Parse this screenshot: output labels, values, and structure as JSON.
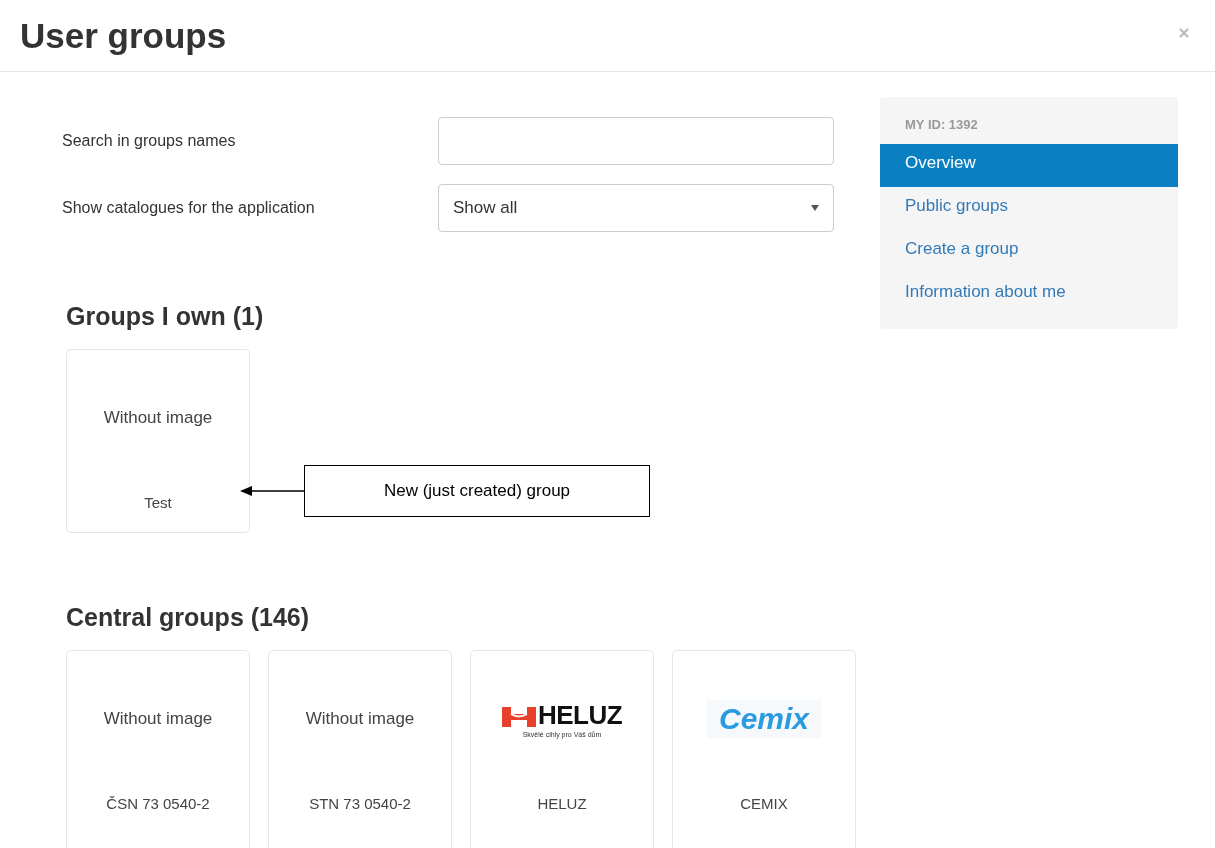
{
  "title": "User groups",
  "form": [
    {
      "kind": "text",
      "label": "Search in groups names"
    },
    {
      "kind": "select",
      "label": "Show catalogues for the application",
      "value": "Show all"
    }
  ],
  "sidebar": {
    "header": "MY ID: 1392",
    "items": [
      {
        "label": "Overview",
        "selected": true
      },
      {
        "label": "Public groups",
        "selected": false
      },
      {
        "label": "Create a group",
        "selected": false
      },
      {
        "label": "Information about me",
        "selected": false
      }
    ]
  },
  "sections": [
    {
      "heading": "Groups I own (1)",
      "groups": [
        {
          "image": {
            "kind": "none",
            "text": "Without image"
          },
          "name": "Test",
          "annotation": "New (just created) group"
        }
      ]
    },
    {
      "heading": "Central groups (146)",
      "groups": [
        {
          "image": {
            "kind": "none",
            "text": "Without image"
          },
          "name": "ČSN 73 0540-2"
        },
        {
          "image": {
            "kind": "none",
            "text": "Without image"
          },
          "name": "STN 73 0540-2"
        },
        {
          "image": {
            "kind": "heluz",
            "text": "HELUZ",
            "tagline": "Skvělé cihly pro Váš dům"
          },
          "name": "HELUZ"
        },
        {
          "image": {
            "kind": "cemix",
            "text": "Cemix"
          },
          "name": "CEMIX"
        }
      ]
    }
  ]
}
